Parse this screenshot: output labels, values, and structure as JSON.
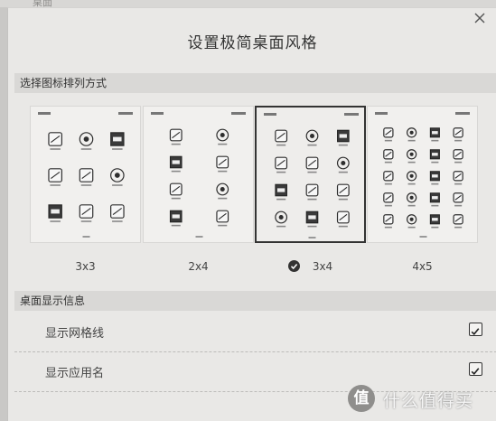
{
  "backdrop": {
    "text": "桌面"
  },
  "dialog": {
    "title": "设置极简桌面风格",
    "section_layout": "选择图标排列方式",
    "section_info": "桌面显示信息",
    "options": [
      {
        "label": "3x3",
        "cols": 3,
        "rows": 3,
        "selected": false
      },
      {
        "label": "2x4",
        "cols": 2,
        "rows": 4,
        "selected": false
      },
      {
        "label": "3x4",
        "cols": 3,
        "rows": 4,
        "selected": true
      },
      {
        "label": "4x5",
        "cols": 4,
        "rows": 5,
        "selected": false
      }
    ],
    "toggles": [
      {
        "label": "显示网格线",
        "checked": true
      },
      {
        "label": "显示应用名",
        "checked": true
      }
    ]
  },
  "watermark": {
    "logo_char": "值",
    "text": "什么值得买"
  },
  "icons": {
    "close": "close-icon",
    "check": "checkmark-icon",
    "app": "app-icon"
  },
  "colors": {
    "dialog_bg": "#e9e8e6",
    "section_bg": "#d9d8d6",
    "accent": "#333333"
  }
}
